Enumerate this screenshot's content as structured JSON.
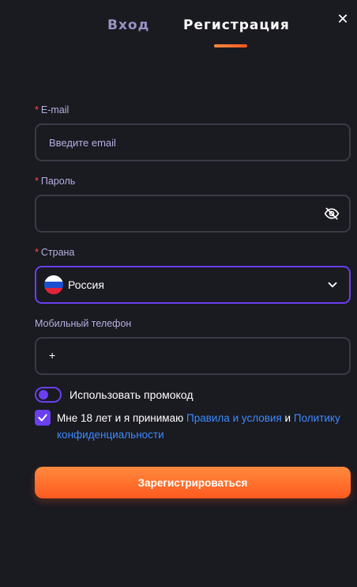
{
  "tabs": {
    "login": "Вход",
    "register": "Регистрация"
  },
  "close_icon": "close-icon",
  "email": {
    "label": "E-mail",
    "placeholder": "Введите email",
    "required": "*"
  },
  "password": {
    "label": "Пароль",
    "value": "",
    "required": "*",
    "icon": "eye-off-icon"
  },
  "country": {
    "label": "Страна",
    "value": "Россия",
    "required": "*",
    "icon": "chevron-down-icon"
  },
  "phone": {
    "label": "Мобильный телефон",
    "value": "+"
  },
  "promo": {
    "label": "Использовать промокод",
    "enabled": false
  },
  "terms": {
    "checked": true,
    "prefix": "Мне 18 лет и я принимаю",
    "link1": "Правила и условия",
    "middle": "и",
    "link2": "Политику конфиденциальности"
  },
  "submit_label": "Зарегистрироваться",
  "colors": {
    "accent": "#6a3ff0",
    "cta_start": "#ff8a3d",
    "cta_end": "#ff5a1f",
    "link": "#3d8bff",
    "required": "#ff4d4d"
  }
}
